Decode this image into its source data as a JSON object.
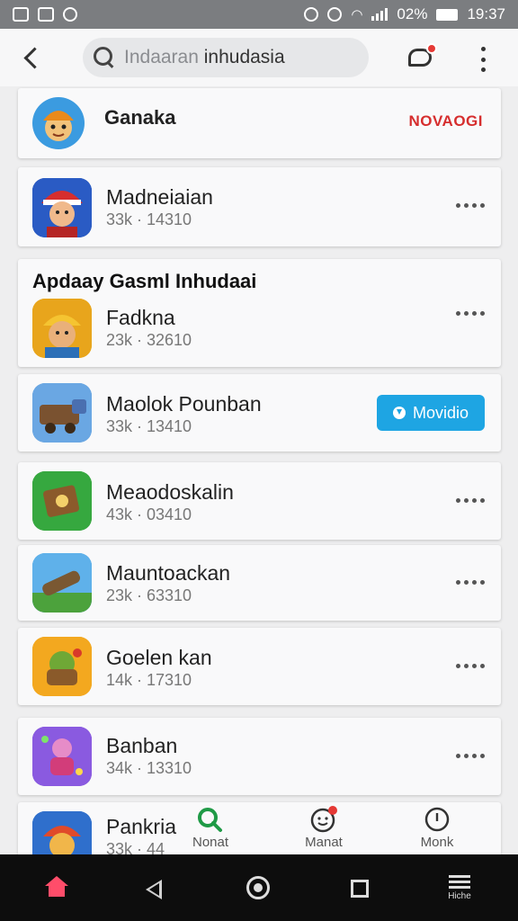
{
  "status_bar": {
    "left_icons": [
      "gallery-icon",
      "image-icon",
      "messenger-icon"
    ],
    "battery": "02%",
    "time": "19:37"
  },
  "app_bar": {
    "search_placeholder": "Indaaran",
    "search_value": "inhudasia"
  },
  "featured": {
    "name": "Ganaka",
    "badge": "NOVAOGI"
  },
  "top_app": {
    "name": "Madneiaian",
    "meta": "33k · 14310"
  },
  "section": {
    "title": "Apdaay Gasml Inhudaai"
  },
  "apps": [
    {
      "name": "Fadkna",
      "meta": "23k · 32610",
      "action": "more"
    },
    {
      "name": "Maolok Pounban",
      "meta": "33k · 13410",
      "action": "install",
      "button_label": "Movidio"
    },
    {
      "name": "Meaodoskalin",
      "meta": "43k · 03410",
      "action": "more"
    },
    {
      "name": "Mauntoackan",
      "meta": "23k · 63310",
      "action": "more"
    },
    {
      "name": "Goelen kan",
      "meta": "14k · 17310",
      "action": "more"
    },
    {
      "name": "Banban",
      "meta": "34k · 13310",
      "action": "more"
    },
    {
      "name": "Pankria",
      "meta": "33k · 44",
      "action": "more"
    }
  ],
  "tabs": [
    {
      "label": "Nonat",
      "icon": "search-icon"
    },
    {
      "label": "Manat",
      "icon": "smiley-icon"
    },
    {
      "label": "Monk",
      "icon": "info-icon"
    }
  ],
  "nav": {
    "menu_label": "Hiche"
  },
  "colors": {
    "accent": "#1ea5e3",
    "badge_red": "#d62e2e",
    "home_pink": "#ff4d6a"
  }
}
